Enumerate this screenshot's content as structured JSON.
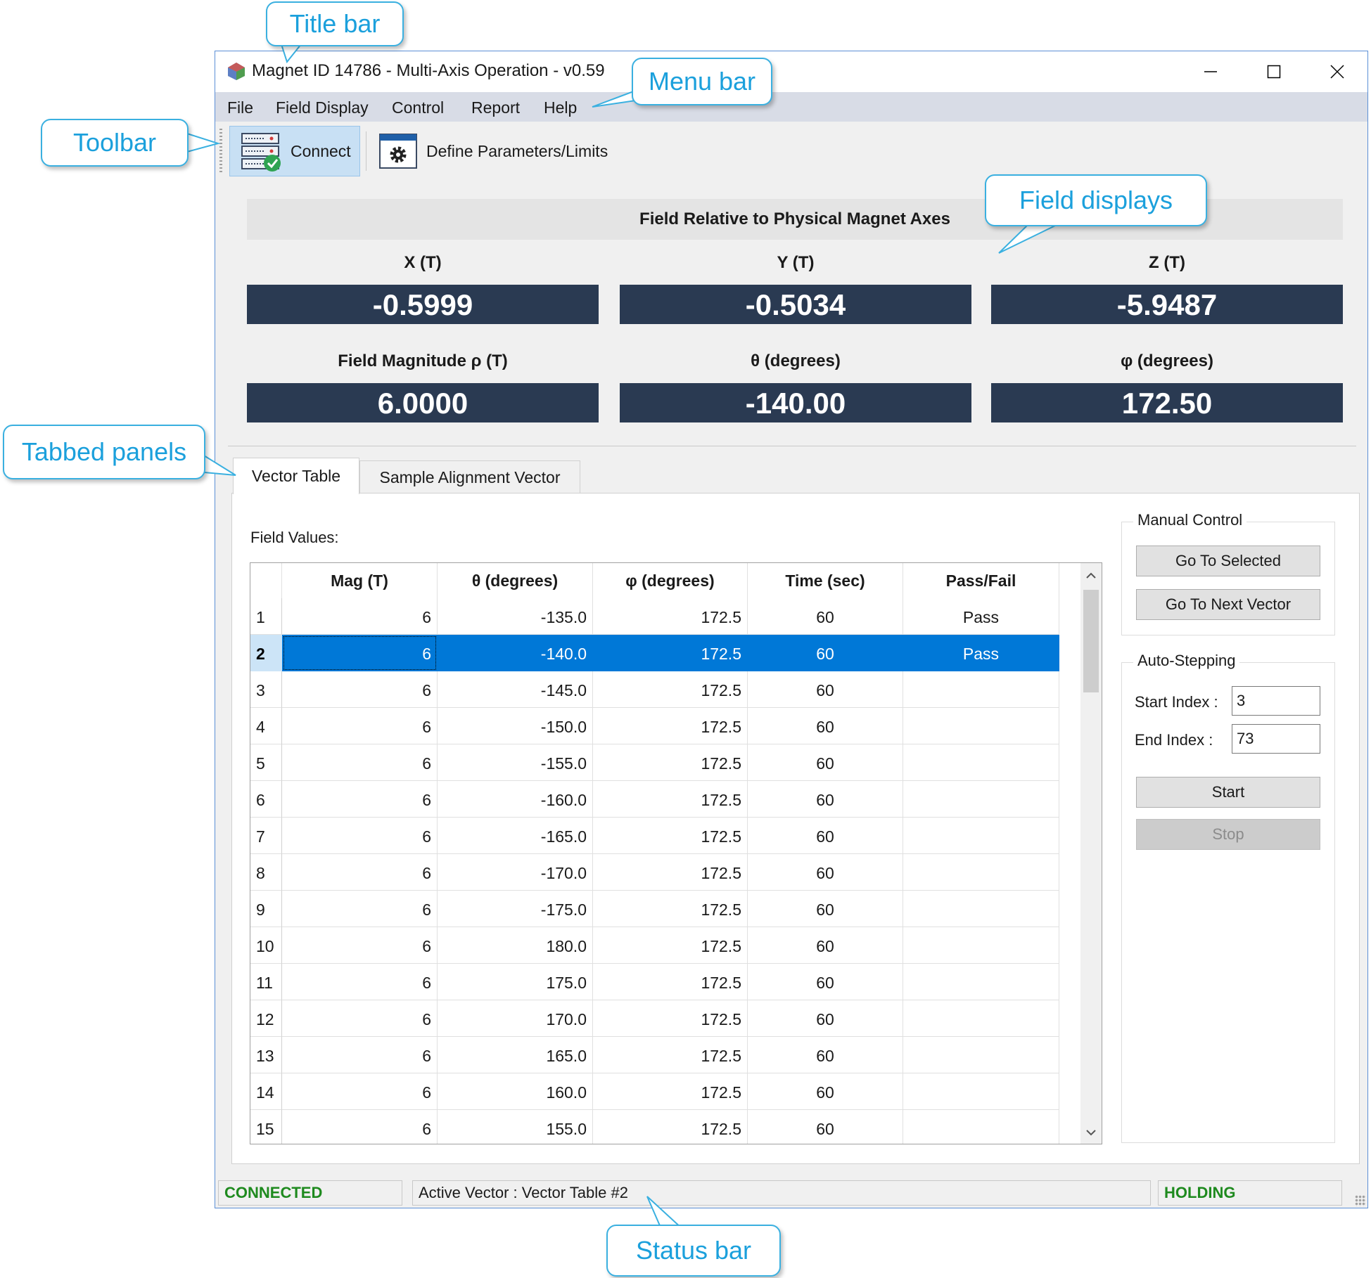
{
  "window": {
    "title": "Magnet ID 14786 - Multi-Axis Operation - v0.59",
    "controls": [
      "minimize-icon",
      "maximize-icon",
      "close-icon"
    ]
  },
  "menu": {
    "items": [
      "File",
      "Field Display",
      "Control",
      "Report",
      "Help"
    ]
  },
  "toolbar": {
    "connect_label": "Connect",
    "define_label": "Define Parameters/Limits"
  },
  "field_display": {
    "header": "Field Relative to Physical Magnet Axes",
    "x_label": "X (T)",
    "x_value": "-0.5999",
    "y_label": "Y (T)",
    "y_value": "-0.5034",
    "z_label": "Z (T)",
    "z_value": "-5.9487",
    "mag_label": "Field Magnitude ρ (T)",
    "mag_value": "6.0000",
    "theta_label": "θ (degrees)",
    "theta_value": "-140.00",
    "phi_label": "φ (degrees)",
    "phi_value": "172.50"
  },
  "tabs": {
    "vector_table": "Vector Table",
    "sample_alignment": "Sample Alignment Vector"
  },
  "vector_table": {
    "field_values_label": "Field Values:",
    "columns": [
      "Mag (T)",
      "θ (degrees)",
      "φ (degrees)",
      "Time (sec)",
      "Pass/Fail"
    ],
    "selected_row": 2,
    "rows": [
      {
        "idx": "1",
        "mag": "6",
        "theta": "-135.0",
        "phi": "172.5",
        "time": "60",
        "pass": "Pass"
      },
      {
        "idx": "2",
        "mag": "6",
        "theta": "-140.0",
        "phi": "172.5",
        "time": "60",
        "pass": "Pass"
      },
      {
        "idx": "3",
        "mag": "6",
        "theta": "-145.0",
        "phi": "172.5",
        "time": "60",
        "pass": ""
      },
      {
        "idx": "4",
        "mag": "6",
        "theta": "-150.0",
        "phi": "172.5",
        "time": "60",
        "pass": ""
      },
      {
        "idx": "5",
        "mag": "6",
        "theta": "-155.0",
        "phi": "172.5",
        "time": "60",
        "pass": ""
      },
      {
        "idx": "6",
        "mag": "6",
        "theta": "-160.0",
        "phi": "172.5",
        "time": "60",
        "pass": ""
      },
      {
        "idx": "7",
        "mag": "6",
        "theta": "-165.0",
        "phi": "172.5",
        "time": "60",
        "pass": ""
      },
      {
        "idx": "8",
        "mag": "6",
        "theta": "-170.0",
        "phi": "172.5",
        "time": "60",
        "pass": ""
      },
      {
        "idx": "9",
        "mag": "6",
        "theta": "-175.0",
        "phi": "172.5",
        "time": "60",
        "pass": ""
      },
      {
        "idx": "10",
        "mag": "6",
        "theta": "180.0",
        "phi": "172.5",
        "time": "60",
        "pass": ""
      },
      {
        "idx": "11",
        "mag": "6",
        "theta": "175.0",
        "phi": "172.5",
        "time": "60",
        "pass": ""
      },
      {
        "idx": "12",
        "mag": "6",
        "theta": "170.0",
        "phi": "172.5",
        "time": "60",
        "pass": ""
      },
      {
        "idx": "13",
        "mag": "6",
        "theta": "165.0",
        "phi": "172.5",
        "time": "60",
        "pass": ""
      },
      {
        "idx": "14",
        "mag": "6",
        "theta": "160.0",
        "phi": "172.5",
        "time": "60",
        "pass": ""
      },
      {
        "idx": "15",
        "mag": "6",
        "theta": "155.0",
        "phi": "172.5",
        "time": "60",
        "pass": ""
      }
    ]
  },
  "manual_control": {
    "title": "Manual Control",
    "go_to_selected": "Go To Selected",
    "go_to_next": "Go To Next Vector"
  },
  "auto_stepping": {
    "title": "Auto-Stepping",
    "start_index_label": "Start Index :",
    "start_index_value": "3",
    "end_index_label": "End Index :",
    "end_index_value": "73",
    "start_label": "Start",
    "stop_label": "Stop"
  },
  "status": {
    "connection": "CONNECTED",
    "active_vector": "Active Vector : Vector Table #2",
    "state": "HOLDING"
  },
  "callouts": {
    "title_bar": "Title bar",
    "menu_bar": "Menu bar",
    "toolbar": "Toolbar",
    "field_displays": "Field displays",
    "tabbed_panels": "Tabbed panels",
    "status_bar": "Status bar"
  },
  "colors": {
    "display_bg": "#2a3a52",
    "selection": "#0078d7",
    "status_green": "#1e8a1e",
    "callout": "#1ba0dc"
  }
}
